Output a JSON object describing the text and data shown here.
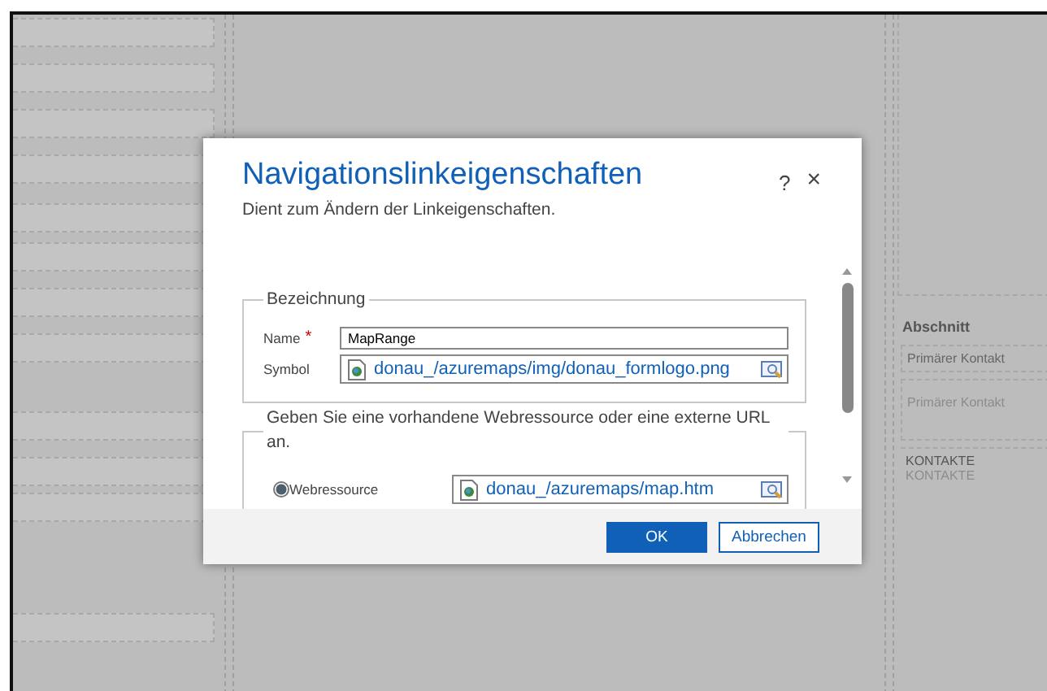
{
  "section": {
    "title": "Abschnitt",
    "fields": [
      {
        "label": "Primärer Kontakt",
        "placeholder": "Primärer Kontakt"
      }
    ],
    "subgrid": {
      "title": "KONTAKTE",
      "label": "KONTAKTE"
    }
  },
  "dialog": {
    "title": "Navigationslinkeigenschaften",
    "subtitle": "Dient zum Ändern der Linkeigenschaften.",
    "help": "?",
    "close": "×",
    "groups": [
      {
        "legend": "Bezeichnung",
        "fields": [
          {
            "kind": "text",
            "label": "Name",
            "required_mark": "*",
            "value": "MapRange"
          },
          {
            "kind": "lookup",
            "label": "Symbol",
            "value": "donau_/azuremaps/img/donau_formlogo.png"
          }
        ]
      },
      {
        "legend": "Geben Sie eine vorhandene Webressource oder eine externe URL an.",
        "fields": [
          {
            "kind": "radio",
            "label": "Webressource",
            "selected": true,
            "value": "donau_/azuremaps/map.htm"
          }
        ]
      }
    ],
    "buttons": [
      {
        "label": "OK",
        "kind": "primary"
      },
      {
        "label": "Abbrechen",
        "kind": "secondary"
      }
    ]
  }
}
